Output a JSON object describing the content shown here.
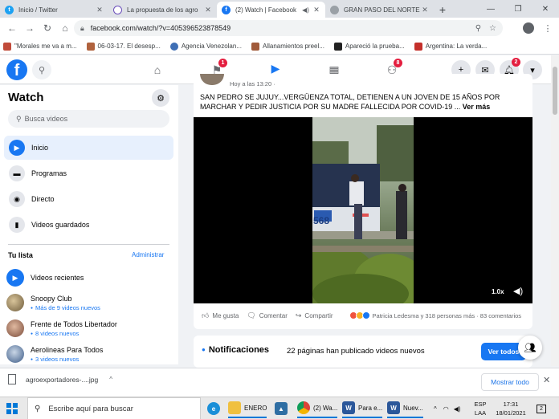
{
  "browser": {
    "tabs": [
      {
        "title": "Inicio / Twitter",
        "icon": "twitter-icon",
        "color": "#1da1f2"
      },
      {
        "title": "La propuesta de los agro",
        "icon": "page-icon",
        "color": "#6b4fbb"
      },
      {
        "title": "(2) Watch | Facebook",
        "icon": "facebook-icon",
        "color": "#1877f2",
        "active": true
      },
      {
        "title": "GRAN PASO DEL NORTE",
        "icon": "globe-icon",
        "color": "#5f6368"
      }
    ],
    "new_tab": "+",
    "url": "facebook.com/watch/?v=405396523878549",
    "bookmarks": [
      {
        "label": "\"Morales me va a m...",
        "color": "#c14b3a"
      },
      {
        "label": "06-03-17. El desesp...",
        "color": "#b0623d"
      },
      {
        "label": "Agencia Venezolan...",
        "color": "#3f6fb5"
      },
      {
        "label": "Allanamientos preel...",
        "color": "#a05a3a"
      },
      {
        "label": "Apareció la prueba...",
        "color": "#222222"
      },
      {
        "label": "Argentina: La verda...",
        "color": "#c4302b"
      }
    ]
  },
  "facebook": {
    "badges": {
      "pages": "1",
      "groups": "8",
      "notifications": "2"
    },
    "sidebar": {
      "title": "Watch",
      "search_placeholder": "Busca videos",
      "items": [
        {
          "label": "Inicio",
          "icon": "play-icon",
          "active": true
        },
        {
          "label": "Programas",
          "icon": "clapper-icon"
        },
        {
          "label": "Directo",
          "icon": "live-icon"
        },
        {
          "label": "Videos guardados",
          "icon": "bookmark-icon"
        }
      ],
      "your_list_title": "Tu lista",
      "admin_link": "Administrar",
      "list": [
        {
          "name": "Videos recientes",
          "sub": "",
          "color": "#1877f2"
        },
        {
          "name": "Snoopy Club",
          "sub": "Más de 9 videos nuevos",
          "color": "#8a6d3b"
        },
        {
          "name": "Frente de Todos Libertador",
          "sub": "8 videos nuevos",
          "color": "#7a4b3a"
        },
        {
          "name": "Aerolineas Para Todos",
          "sub": "3 videos nuevos",
          "color": "#3b5a86"
        }
      ]
    },
    "post": {
      "time": "Hoy a las 13:20 · ",
      "text": "SAN PEDRO SE JUJUY...VERGÜENZA TOTAL, DETIENEN A UN JOVEN DE 15 AÑOS POR MARCHAR Y PEDIR JUSTICIA POR SU MADRE FALLECIDA POR COVID-19 ... ",
      "more": "Ver más",
      "video_speed": "1.0x",
      "van_number": "568",
      "actions": {
        "like": "Me gusta",
        "comment": "Comentar",
        "share": "Compartir"
      },
      "reactions_text": "Patricia Ledesma y 318 personas más · 83 comentarios"
    },
    "notifications": {
      "title": "Notificaciones",
      "summary": "22 páginas han publicado videos nuevos",
      "button": "Ver todos"
    }
  },
  "downloads": {
    "file": "agroexportadores-....jpg",
    "show_all": "Mostrar todo"
  },
  "taskbar": {
    "search_placeholder": "Escribe aquí para buscar",
    "apps": [
      {
        "label": "ENERO",
        "icon": "folder-icon",
        "color": "#f0c040"
      },
      {
        "label": "(2) Wa...",
        "icon": "chrome-icon",
        "color": "#db4437"
      },
      {
        "label": "Para e...",
        "icon": "word-icon",
        "color": "#2b579a"
      },
      {
        "label": "Nuev...",
        "icon": "word-icon",
        "color": "#2b579a"
      }
    ],
    "lang_top": "ESP",
    "lang_bottom": "LAA",
    "time": "17:31",
    "date": "18/01/2021",
    "notif_count": "2"
  }
}
